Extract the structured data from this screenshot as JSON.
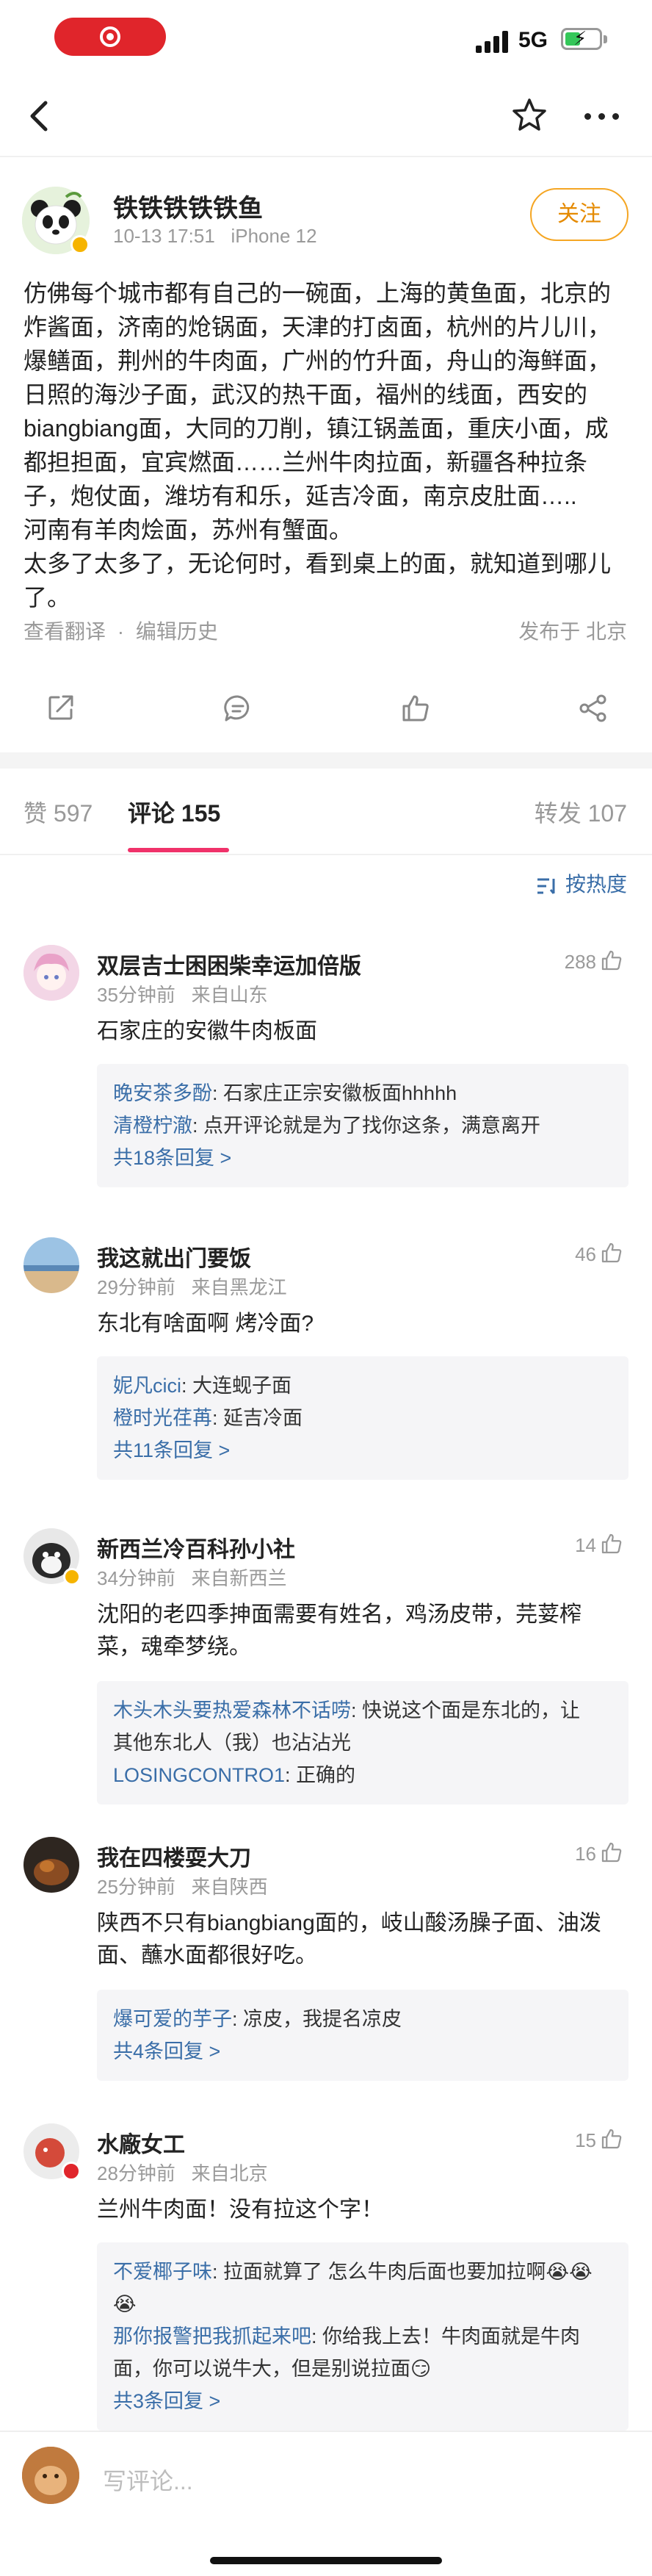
{
  "status_bar": {
    "network": "5G"
  },
  "post": {
    "author": "铁铁铁铁铁鱼",
    "time": "10-13 17:51",
    "device": "iPhone 12",
    "follow_label": "关注",
    "content_lines": [
      "仿佛每个城市都有自己的一碗面，上海的黄鱼面，北京的",
      "炸酱面，济南的炝锅面，天津的打卤面，杭州的片儿川，",
      "爆鳝面，荆州的牛肉面，广州的竹升面，舟山的海鲜面，",
      "日照的海沙子面，武汉的热干面，福州的线面，西安的",
      "biangbiang面，大同的刀削，镇江锅盖面，重庆小面，成",
      "都担担面，宜宾燃面……兰州牛肉拉面，新疆各种拉条",
      "子，炮仗面，潍坊有和乐，延吉冷面，南京皮肚面…..",
      "河南有羊肉烩面，苏州有蟹面。",
      "太多了太多了，无论何时，看到桌上的面，就知道到哪儿",
      "了。"
    ],
    "translate_label": "查看翻译",
    "separator": "·",
    "edit_history_label": "编辑历史",
    "location": "发布于 北京"
  },
  "tabs": {
    "likes_label": "赞",
    "likes_count": "597",
    "comments_label": "评论",
    "comments_count": "155",
    "reposts_label": "转发",
    "reposts_count": "107"
  },
  "sort_label": "按热度",
  "comments": [
    {
      "name": "双层吉士困困柴幸运加倍版",
      "time": "35分钟前",
      "from": "来自山东",
      "likes": "288",
      "text": "石家庄的安徽牛肉板面",
      "replies": [
        {
          "name": "晚安茶多酚",
          "text": "石家庄正宗安徽板面hhhhh"
        },
        {
          "name": "清橙柠澈",
          "text": "点开评论就是为了找你这条，满意离开"
        }
      ],
      "more": "共18条回复 >"
    },
    {
      "name": "我这就出门要饭",
      "time": "29分钟前",
      "from": "来自黑龙江",
      "likes": "46",
      "text": "东北有啥面啊 烤冷面?",
      "replies": [
        {
          "name": "妮凡cici",
          "text": "大连蚬子面"
        },
        {
          "name": "橙时光荏苒",
          "text": "延吉冷面"
        }
      ],
      "more": "共11条回复 >"
    },
    {
      "name": "新西兰冷百科孙小社",
      "time": "34分钟前",
      "from": "来自新西兰",
      "likes": "14",
      "text_lines": [
        "沈阳的老四季抻面需要有姓名，鸡汤皮带，芫荽榨",
        "菜，魂牵梦绕。"
      ],
      "replies": [
        {
          "name": "木头木头要热爱森林不话唠",
          "text": "快说这个面是东北的，让",
          "text2": "其他东北人（我）也沾沾光"
        },
        {
          "name": "LOSINGCONTRO1",
          "text": "正确的"
        }
      ]
    },
    {
      "name": "我在四楼耍大刀",
      "time": "25分钟前",
      "from": "来自陕西",
      "likes": "16",
      "text_lines": [
        "陕西不只有biangbiang面的，岐山酸汤臊子面、油泼",
        "面、蘸水面都很好吃。"
      ],
      "replies": [
        {
          "name": "爆可爱的芋子",
          "text": "凉皮，我提名凉皮"
        }
      ],
      "more": "共4条回复 >"
    },
    {
      "name": "水廠女工",
      "time": "28分钟前",
      "from": "来自北京",
      "likes": "15",
      "text": "兰州牛肉面！没有拉这个字！",
      "replies": [
        {
          "name": "不爱椰子味",
          "text": "拉面就算了 怎么牛肉后面也要加拉啊😭😭",
          "text2": "😭"
        },
        {
          "name": "那你报警把我抓起来吧",
          "text": "你给我上去！牛肉面就是牛肉",
          "text2": "面，你可以说牛大，但是别说拉面😏"
        }
      ],
      "more": "共3条回复 >"
    }
  ],
  "comment_input_placeholder": "写评论...",
  "colors": {
    "accent": "#f0326a",
    "link": "#3a6ea8",
    "follow": "#f5a623",
    "record": "#e0252b"
  }
}
